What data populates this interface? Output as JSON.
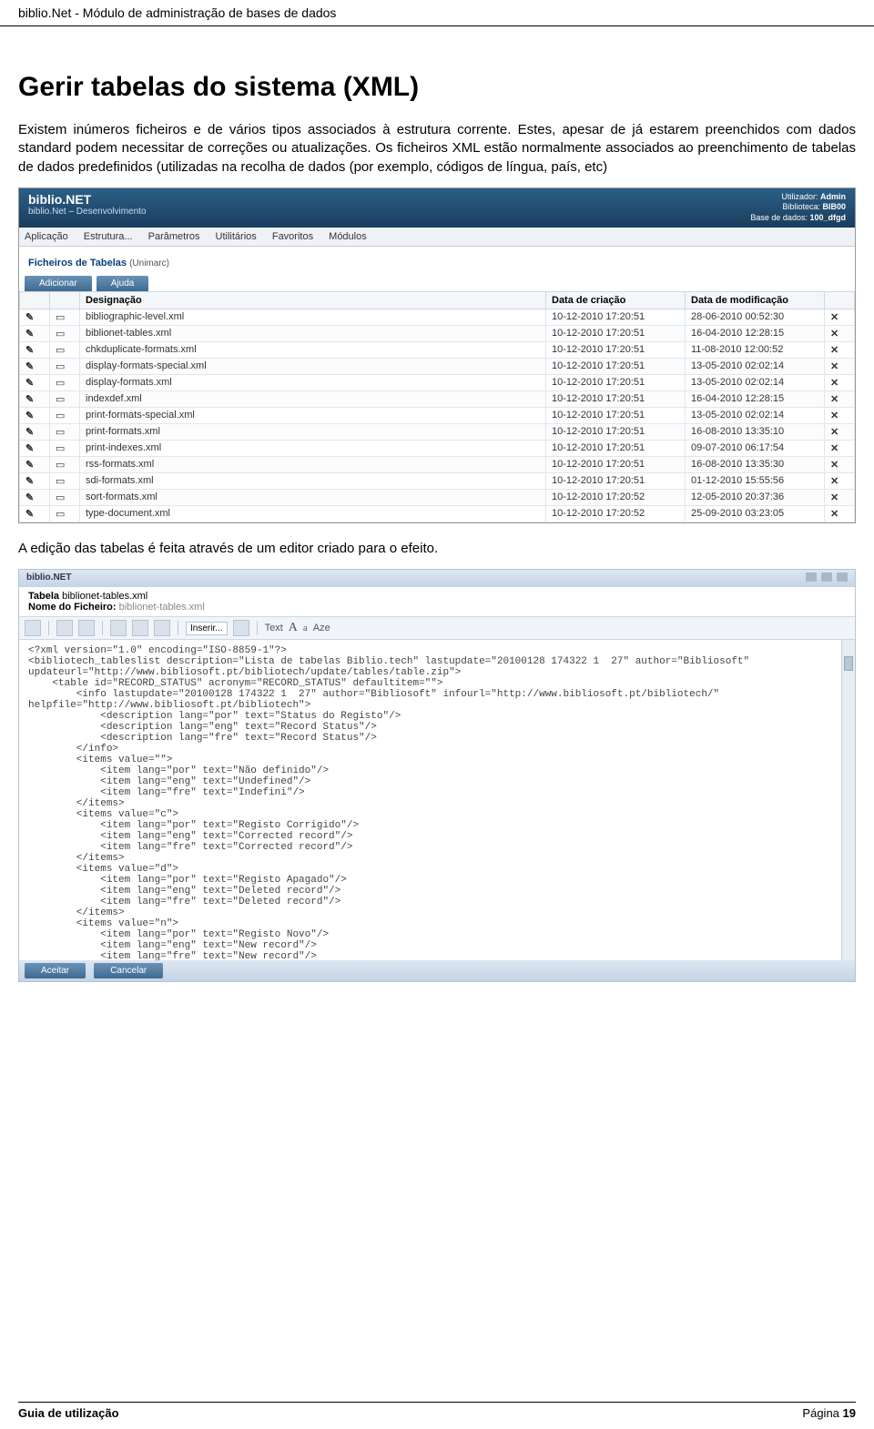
{
  "doc_header": "biblio.Net - Módulo de administração de bases de dados",
  "heading": "Gerir tabelas do sistema (XML)",
  "para1": "Existem inúmeros ficheiros e de vários tipos associados à estrutura corrente. Estes, apesar de já estarem preenchidos com dados standard podem necessitar de correções ou atualizações. Os ficheiros XML estão normalmente associados ao preenchimento de tabelas de dados predefinidos (utilizadas na recolha de dados (por exemplo, códigos de língua, país, etc)",
  "para2": "A edição das tabelas é feita através de um editor criado para o efeito.",
  "app": {
    "brand": "biblio.NET",
    "subtitle": "biblio.Net – Desenvolvimento",
    "user_label": "Utilizador:",
    "user": "Admin",
    "bib_label": "Biblioteca:",
    "bib": "BIB00",
    "db_label": "Base de dados:",
    "db": "100_dfgd",
    "menus": [
      "Aplicação",
      "Estrutura...",
      "Parâmetros",
      "Utilitários",
      "Favoritos",
      "Módulos"
    ],
    "section_title": "Ficheiros de Tabelas",
    "section_sub": "(Unimarc)",
    "tabs": [
      "Adicionar",
      "Ajuda"
    ],
    "columns": [
      "",
      "",
      "Designação",
      "Data de criação",
      "Data de modificação",
      ""
    ],
    "tooltip": "bibliographic-level.xml",
    "rows": [
      {
        "name": "bibliographic-level.xml",
        "created": "10-12-2010 17:20:51",
        "modified": "28-06-2010 00:52:30"
      },
      {
        "name": "biblionet-tables.xml",
        "created": "10-12-2010 17:20:51",
        "modified": "16-04-2010 12:28:15"
      },
      {
        "name": "chkduplicate-formats.xml",
        "created": "10-12-2010 17:20:51",
        "modified": "11-08-2010 12:00:52"
      },
      {
        "name": "display-formats-special.xml",
        "created": "10-12-2010 17:20:51",
        "modified": "13-05-2010 02:02:14"
      },
      {
        "name": "display-formats.xml",
        "created": "10-12-2010 17:20:51",
        "modified": "13-05-2010 02:02:14"
      },
      {
        "name": "indexdef.xml",
        "created": "10-12-2010 17:20:51",
        "modified": "16-04-2010 12:28:15"
      },
      {
        "name": "print-formats-special.xml",
        "created": "10-12-2010 17:20:51",
        "modified": "13-05-2010 02:02:14"
      },
      {
        "name": "print-formats.xml",
        "created": "10-12-2010 17:20:51",
        "modified": "16-08-2010 13:35:10"
      },
      {
        "name": "print-indexes.xml",
        "created": "10-12-2010 17:20:51",
        "modified": "09-07-2010 06:17:54"
      },
      {
        "name": "rss-formats.xml",
        "created": "10-12-2010 17:20:51",
        "modified": "16-08-2010 13:35:30"
      },
      {
        "name": "sdi-formats.xml",
        "created": "10-12-2010 17:20:51",
        "modified": "01-12-2010 15:55:56"
      },
      {
        "name": "sort-formats.xml",
        "created": "10-12-2010 17:20:52",
        "modified": "12-05-2010 20:37:36"
      },
      {
        "name": "type-document.xml",
        "created": "10-12-2010 17:20:52",
        "modified": "25-09-2010 03:23:05"
      }
    ]
  },
  "editor": {
    "brand": "biblio.NET",
    "tab_title_prefix": "Tabela",
    "tab_title_file": "biblionet-tables.xml",
    "file_label": "Nome do Ficheiro:",
    "file_name": "biblionet-tables.xml",
    "toolbar_insert": "Inserir...",
    "toolbar_text": "Text",
    "toolbar_a1": "A",
    "toolbar_a2": "a",
    "toolbar_a3": "Aze",
    "buttons": {
      "accept": "Aceitar",
      "cancel": "Cancelar"
    },
    "xml": "<?xml version=\"1.0\" encoding=\"ISO-8859-1\"?>\n<bibliotech_tableslist description=\"Lista de tabelas Biblio.tech\" lastupdate=\"20100128 174322 1  27\" author=\"Bibliosoft\"\nupdateurl=\"http://www.bibliosoft.pt/bibliotech/update/tables/table.zip\">\n    <table id=\"RECORD_STATUS\" acronym=\"RECORD_STATUS\" defaultitem=\"\">\n        <info lastupdate=\"20100128 174322 1  27\" author=\"Bibliosoft\" infourl=\"http://www.bibliosoft.pt/bibliotech/\"\nhelpfile=\"http://www.bibliosoft.pt/bibliotech\">\n            <description lang=\"por\" text=\"Status do Registo\"/>\n            <description lang=\"eng\" text=\"Record Status\"/>\n            <description lang=\"fre\" text=\"Record Status\"/>\n        </info>\n        <items value=\"\">\n            <item lang=\"por\" text=\"Não definido\"/>\n            <item lang=\"eng\" text=\"Undefined\"/>\n            <item lang=\"fre\" text=\"Indefini\"/>\n        </items>\n        <items value=\"c\">\n            <item lang=\"por\" text=\"Registo Corrigido\"/>\n            <item lang=\"eng\" text=\"Corrected record\"/>\n            <item lang=\"fre\" text=\"Corrected record\"/>\n        </items>\n        <items value=\"d\">\n            <item lang=\"por\" text=\"Registo Apagado\"/>\n            <item lang=\"eng\" text=\"Deleted record\"/>\n            <item lang=\"fre\" text=\"Deleted record\"/>\n        </items>\n        <items value=\"n\">\n            <item lang=\"por\" text=\"Registo Novo\"/>\n            <item lang=\"eng\" text=\"New record\"/>\n            <item lang=\"fre\" text=\"New record\"/>\n        </items>\n        <items value=\"o\">\n            <item lang=\"por\" text=\"Registo Anterior de nível mais elevado\"/>\n            <item lang=\"eng\" text=\"Previously issued higher level record\"/>"
  },
  "footer": {
    "left": "Guia de utilização",
    "right_label": "Página",
    "right_num": "19"
  }
}
